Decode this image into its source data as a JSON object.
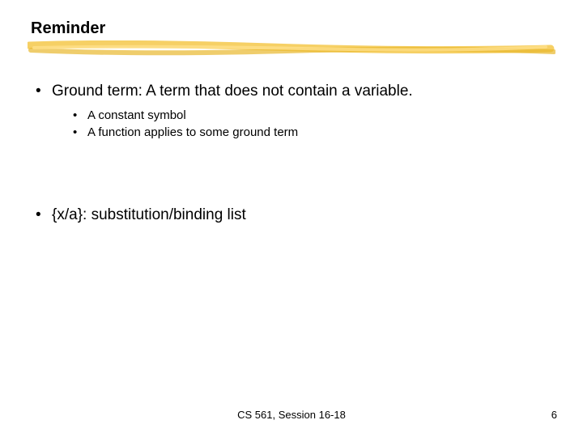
{
  "title": "Reminder",
  "bullets": {
    "b0": {
      "text": "Ground term: A term that does not contain a variable.",
      "sub": {
        "s0": "A constant symbol",
        "s1": "A function applies to some ground term"
      }
    },
    "b1": {
      "text": "{x/a}: substitution/binding list"
    }
  },
  "footer": "CS 561, Session 16-18",
  "page_number": "6"
}
